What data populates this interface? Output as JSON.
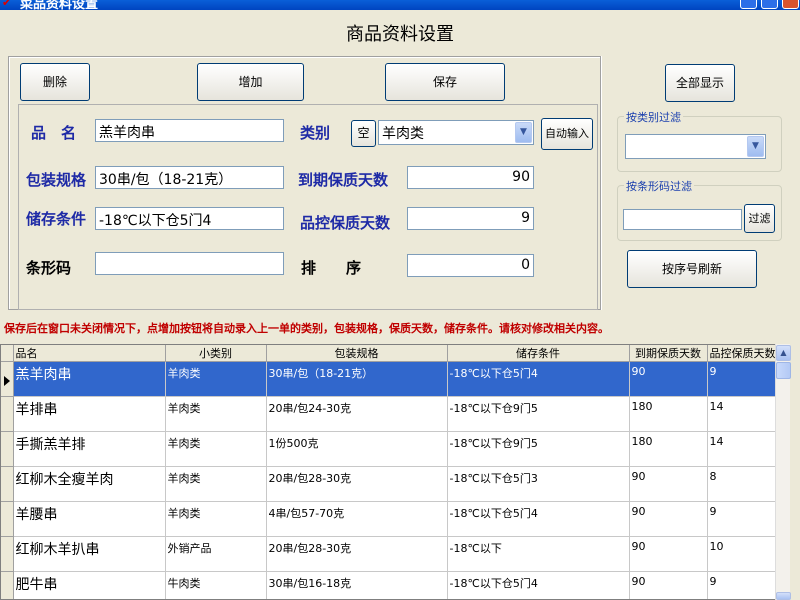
{
  "window": {
    "title": "菜品资料设置",
    "title_icon": "check-mark-icon"
  },
  "form": {
    "title": "商品资料设置"
  },
  "toolbar": {
    "delete_label": "删除",
    "add_label": "增加",
    "save_label": "保存"
  },
  "fields": {
    "name_label": "品　名",
    "name_value": "羔羊肉串",
    "category_label": "类别",
    "category_clear_label": "空",
    "category_value": "羊肉类",
    "auto_input_label": "自动输入",
    "package_label": "包装规格",
    "package_value": "30串/包（18-21克）",
    "expiry_days_label": "到期保质天数",
    "expiry_days_value": "90",
    "storage_label": "储存条件",
    "storage_value": "-18℃以下仓5门4",
    "qc_days_label": "品控保质天数",
    "qc_days_value": "9",
    "barcode_label": "条形码",
    "barcode_value": "",
    "sort_label": "排　　序",
    "sort_value": "0"
  },
  "right_panel": {
    "show_all_label": "全部显示",
    "filter_category_legend": "按类别过滤",
    "filter_category_value": "",
    "filter_barcode_legend": "按条形码过滤",
    "filter_barcode_value": "",
    "filter_button_label": "过滤",
    "refresh_by_order_label": "按序号刷新"
  },
  "notice": "保存后在窗口未关闭情况下，点增加按钮将自动录入上一单的类别，包装规格，保质天数，储存条件。请核对修改相关内容。",
  "grid": {
    "columns": [
      "品名",
      "小类别",
      "包装规格",
      "储存条件",
      "到期保质天数",
      "品控保质天数"
    ],
    "rows": [
      {
        "name": "羔羊肉串",
        "category": "羊肉类",
        "package": "30串/包（18-21克）",
        "storage": "-18℃以下仓5门4",
        "expiry": "90",
        "qc": "9"
      },
      {
        "name": "羊排串",
        "category": "羊肉类",
        "package": "20串/包24-30克",
        "storage": "-18℃以下仓9门5",
        "expiry": "180",
        "qc": "14"
      },
      {
        "name": "手撕羔羊排",
        "category": "羊肉类",
        "package": "1份500克",
        "storage": "-18℃以下仓9门5",
        "expiry": "180",
        "qc": "14"
      },
      {
        "name": "红柳木全瘦羊肉",
        "category": "羊肉类",
        "package": "20串/包28-30克",
        "storage": "-18℃以下仓5门3",
        "expiry": "90",
        "qc": "8"
      },
      {
        "name": "羊腰串",
        "category": "羊肉类",
        "package": "4串/包57-70克",
        "storage": "-18℃以下仓5门4",
        "expiry": "90",
        "qc": "9"
      },
      {
        "name": "红柳木羊扒串",
        "category": "外销产品",
        "package": "20串/包28-30克",
        "storage": "-18℃以下",
        "expiry": "90",
        "qc": "10"
      },
      {
        "name": "肥牛串",
        "category": "牛肉类",
        "package": "30串/包16-18克",
        "storage": "-18℃以下仓5门4",
        "expiry": "90",
        "qc": "9"
      }
    ]
  }
}
